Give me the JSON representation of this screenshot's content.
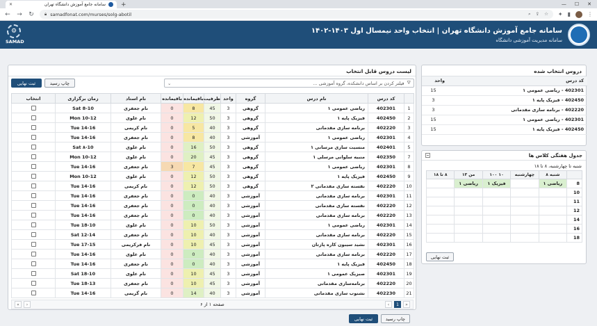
{
  "browser": {
    "tab_title": "سامانه جامع آموزش دانشگاه تهران",
    "url": "samadfonat.com/murses/solg-abotil"
  },
  "header": {
    "title": "سامانه جامع آموزش دانشگاه تهران | انتخاب واحد نیمسال اول ۱۴۰۳-۱۴۰۲",
    "subtitle": "سامانه مدیریت آموزشی دانشگاه",
    "logo_text": "SAMAD",
    "brand_color": "#1f4e79"
  },
  "main": {
    "title": "لیست دروس قابل انتخاب",
    "register_btn": "ثبت نهایی",
    "print_btn": "چاپ رسید",
    "filter_placeholder": "فیلتر کردن بر اساس دانشکده، گروه آموزشی ...",
    "columns": [
      "",
      "کد درس",
      "نام درس",
      "گروه",
      "واحد",
      "ظرفیت",
      "باقیمانده",
      "باقیمانده",
      "نام استاد",
      "زمان برگزاری",
      "انتخاب"
    ],
    "rows": [
      {
        "n": "1",
        "code": "402301",
        "name": "ریاضی عمومی ۱",
        "group": "گروهی",
        "unit": "3",
        "cap": "45",
        "rem1": "8",
        "rem2": "0",
        "prof": "نام جعفری",
        "time": "Sat 8-10"
      },
      {
        "n": "2",
        "code": "402450",
        "name": "فیزیک پایه ۱",
        "group": "گروهی",
        "unit": "3",
        "cap": "50",
        "rem1": "12",
        "rem2": "0",
        "prof": "نام علوی",
        "time": "Mon 10-12"
      },
      {
        "n": "3",
        "code": "402220",
        "name": "برنامه سازی مقدماتی",
        "group": "گروهی",
        "unit": "3",
        "cap": "40",
        "rem1": "5",
        "rem2": "0",
        "prof": "نام کریمی",
        "time": "Tue 14-16"
      },
      {
        "n": "4",
        "code": "402301",
        "name": "ریاضی عمومی ۱",
        "group": "آموزشی",
        "unit": "3",
        "cap": "40",
        "rem1": "8",
        "rem2": "0",
        "prof": "نام جعفری",
        "time": "Tue 14-16"
      },
      {
        "n": "5",
        "code": "402401",
        "name": "منسیت سازی مرسانی ۱",
        "group": "گروهی",
        "unit": "3",
        "cap": "50",
        "rem1": "16",
        "rem2": "0",
        "prof": "نام علوی",
        "time": "Sat ۸-10"
      },
      {
        "n": "7",
        "code": "402350",
        "name": "منبیه سلوانی مرسلی ۱",
        "group": "گروهی",
        "unit": "3",
        "cap": "45",
        "rem1": "20",
        "rem2": "0",
        "prof": "نام علوی",
        "time": "Mon 10-12"
      },
      {
        "n": "8",
        "code": "402301",
        "name": "ریاضی عمومی ۱",
        "group": "گروهی",
        "unit": "3",
        "cap": "45",
        "rem1": "7",
        "rem2": "3",
        "prof": "نام جعفری",
        "time": "Tue 14-16"
      },
      {
        "n": "9",
        "code": "402450",
        "name": "فیزیک پایه ۱",
        "group": "گروهی",
        "unit": "3",
        "cap": "50",
        "rem1": "12",
        "rem2": "0",
        "prof": "نام علوی",
        "time": "Mon 10-12"
      },
      {
        "n": "10",
        "code": "402220",
        "name": "نقسته سازی مقدماتی ۲",
        "group": "گروهی",
        "unit": "3",
        "cap": "50",
        "rem1": "12",
        "rem2": "0",
        "prof": "نام کریمی",
        "time": "Tue 14-16"
      },
      {
        "n": "11",
        "code": "402301",
        "name": "برنامه سازی مقدماتی",
        "group": "آموزشی",
        "unit": "3",
        "cap": "40",
        "rem1": "0",
        "rem2": "0",
        "prof": "نام جعفری",
        "time": "Tue 14-16"
      },
      {
        "n": "12",
        "code": "402220",
        "name": "نقسته سازی مقدماتی",
        "group": "آموزشی",
        "unit": "3",
        "cap": "40",
        "rem1": "0",
        "rem2": "0",
        "prof": "نام جعفری",
        "time": "Tue 14-16"
      },
      {
        "n": "13",
        "code": "402220",
        "name": "برنامه سازی مقدماتی",
        "group": "آموزشی",
        "unit": "3",
        "cap": "40",
        "rem1": "0",
        "rem2": "0",
        "prof": "نام جعفری",
        "time": "Tue 14-16"
      },
      {
        "n": "14",
        "code": "402301",
        "name": "ریاضی عمومی ۱",
        "group": "آموزشی",
        "unit": "3",
        "cap": "50",
        "rem1": "10",
        "rem2": "0",
        "prof": "نام علوی",
        "time": "Tue 18-10"
      },
      {
        "n": "15",
        "code": "402220",
        "name": "برنامه سازی مقدماتی",
        "group": "آموزشی",
        "unit": "3",
        "cap": "40",
        "rem1": "10",
        "rem2": "0",
        "prof": "نام جعفری",
        "time": "Sat 12-14"
      },
      {
        "n": "16",
        "code": "402301",
        "name": "نشید سیبون کاره پازتان",
        "group": "آموزشی",
        "unit": "3",
        "cap": "45",
        "rem1": "10",
        "rem2": "0",
        "prof": "نام فرکریمی",
        "time": "Tue 17-15"
      },
      {
        "n": "17",
        "code": "402220",
        "name": "برنامه سازی مقدماتی",
        "group": "آموزشی",
        "unit": "3",
        "cap": "40",
        "rem1": "0",
        "rem2": "0",
        "prof": "نام علوی",
        "time": "Tue 14-16"
      },
      {
        "n": "18",
        "code": "402450",
        "name": "فیزیک پایه ۱",
        "group": "آموزشی",
        "unit": "3",
        "cap": "40",
        "rem1": "0",
        "rem2": "0",
        "prof": "نام جعفری",
        "time": "Tue 14-16"
      },
      {
        "n": "19",
        "code": "402301",
        "name": "صبزیک عمومی ۱",
        "group": "آموزشی",
        "unit": "3",
        "cap": "45",
        "rem1": "10",
        "rem2": "0",
        "prof": "نام علوی",
        "time": "Sat 18-10"
      },
      {
        "n": "20",
        "code": "402220",
        "name": "برنامه‌سازی مقدماتی",
        "group": "آموزشی",
        "unit": "3",
        "cap": "45",
        "rem1": "10",
        "rem2": "0",
        "prof": "نام جعفری",
        "time": "Tue 18-13"
      },
      {
        "n": "21",
        "code": "402230",
        "name": "نشنوب سازی مقدماتی",
        "group": "آموزشی",
        "unit": "3",
        "cap": "40",
        "rem1": "14",
        "rem2": "0",
        "prof": "نام گریمی",
        "time": "Tue 14-16"
      }
    ],
    "pager": {
      "info": "صفحه ۱ از ۶",
      "current": "1"
    },
    "bottom_register_btn": "ثبت نهایی",
    "bottom_print_btn": "چاپ رسید"
  },
  "selected": {
    "title": "دروس انتخاب شده",
    "col_code": "کد درس",
    "col_unit": "واحد",
    "rows": [
      {
        "name": "402301 - ریاضی عمومی ۱",
        "unit": "15"
      },
      {
        "name": "402450 - فیزیک پایه ۱",
        "unit": "3"
      },
      {
        "name": "402220 - برنامه سازی مقدماتی",
        "unit": "3"
      },
      {
        "name": "402301 - ریاضی عمومی ۱",
        "unit": "15"
      },
      {
        "name": "402450 - فیزیک پایه ۱",
        "unit": "15"
      }
    ]
  },
  "schedule": {
    "title": "جدول هفتگی کلاس ها",
    "subtitle": "شنبه تا چهارشنبه، ۸ تا ۱۸",
    "days": [
      "شنبه ۸",
      "چهارشنبه",
      "۱۰ ۱۰۰",
      "من ۱۳",
      "۸ تا ۱۸"
    ],
    "hours": [
      "8",
      "10",
      "11",
      "12",
      "14",
      "16",
      "18"
    ],
    "slot1": "ریاضی ۱",
    "slot2": "فیزیک ۱",
    "slot3": "ریاضی ۱",
    "register_btn": "ثبت نهایی"
  }
}
